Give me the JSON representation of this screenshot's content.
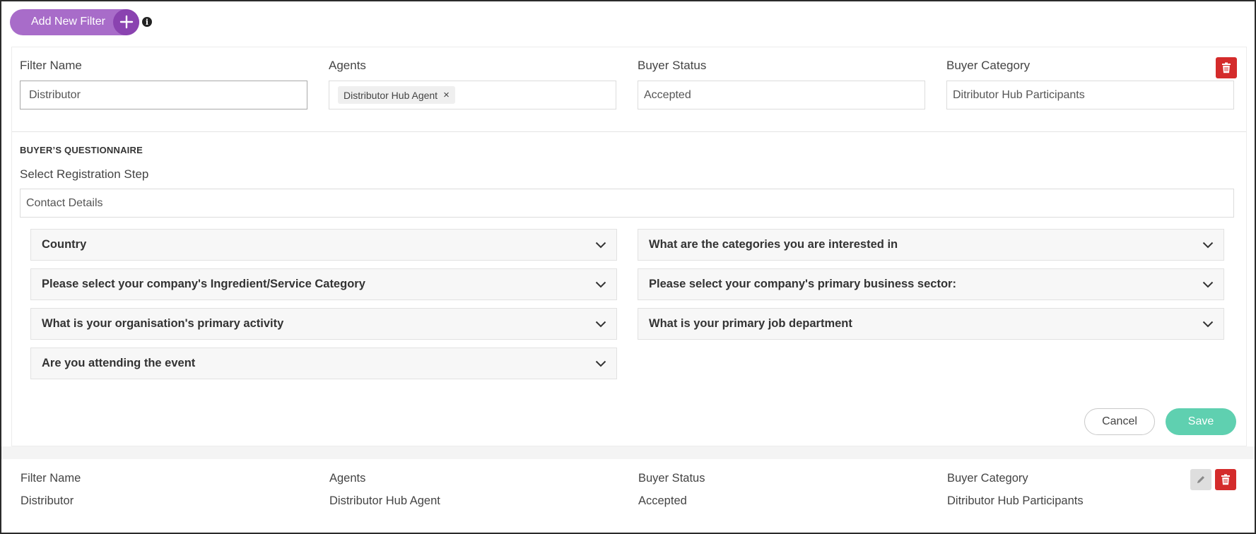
{
  "toolbar": {
    "add_filter_label": "Add New Filter",
    "icons": {
      "add": "plus-icon",
      "info": "info-icon"
    }
  },
  "filter_form": {
    "filter_name": {
      "label": "Filter Name",
      "value": "Distributor"
    },
    "agents": {
      "label": "Agents",
      "tags": [
        "Distributor Hub Agent"
      ]
    },
    "buyer_status": {
      "label": "Buyer Status",
      "value": "Accepted"
    },
    "buyer_category": {
      "label": "Buyer Category",
      "value": "Ditributor Hub Participants"
    },
    "questionnaire": {
      "title": "BUYER’S QUESTIONNAIRE",
      "step_label": "Select Registration Step",
      "step_value": "Contact Details",
      "questions_left": [
        "Country",
        "Please select your company's Ingredient/Service Category",
        "What is your organisation's primary activity",
        "Are you attending the event"
      ],
      "questions_right": [
        "What are the categories you are interested in",
        "Please select your company's primary business sector:",
        "What is your primary job department"
      ]
    },
    "cancel_label": "Cancel",
    "save_label": "Save"
  },
  "saved_filter": {
    "labels": {
      "filter_name": "Filter Name",
      "agents": "Agents",
      "buyer_status": "Buyer Status",
      "buyer_category": "Buyer Category"
    },
    "values": {
      "filter_name": "Distributor",
      "agents": "Distributor Hub Agent",
      "buyer_status": "Accepted",
      "buyer_category": "Ditributor Hub Participants"
    }
  },
  "colors": {
    "accent_purple": "#a86cc9",
    "accent_purple_dark": "#8a43b0",
    "danger": "#d42b2b",
    "save_green": "#5fd0b0"
  }
}
